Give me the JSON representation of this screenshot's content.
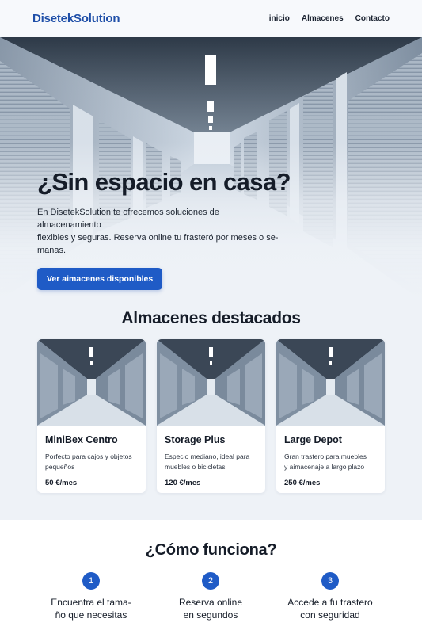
{
  "nav": {
    "brand": "DisetekSolution",
    "links": [
      "inicio",
      "Almacenes",
      "Contacto"
    ]
  },
  "hero": {
    "title": "¿Sin espacio en casa?",
    "text_lines": [
      "En DisetekSolution te ofrecemos soluciones de almacenamiento",
      "flexibles y seguras. Reserva online tu frasteró por meses o se-",
      "manas."
    ],
    "button": "Ver aimacenes disponibles"
  },
  "featured": {
    "title": "Almacenes destacados",
    "cards": [
      {
        "name": "MiniBex Centro",
        "desc_lines": [
          "Porfecto para cajos y objetos",
          "pequeños"
        ],
        "price": "50 €/mes"
      },
      {
        "name": "Storage Plus",
        "desc_lines": [
          "Especio mediano, ideal para",
          "muebles o bicicletas"
        ],
        "price": "120 €/mes"
      },
      {
        "name": "Large Depot",
        "desc_lines": [
          "Gran trastero para muebles",
          "y aimacenaje a largo plazo"
        ],
        "price": "250 €/mes"
      }
    ]
  },
  "how": {
    "title": "¿Cómo funciona?",
    "steps": [
      {
        "num": "1",
        "lines": [
          "Encuentra el tama-",
          "ño que necesitas"
        ]
      },
      {
        "num": "2",
        "lines": [
          "Reserva online",
          "en segundos"
        ]
      },
      {
        "num": "3",
        "lines": [
          "Accede a fu trastero",
          "con seguridad"
        ]
      }
    ]
  },
  "colors": {
    "accent": "#1f5bc6",
    "brand": "#1f4fa8",
    "page_bg": "#eef2f7"
  }
}
